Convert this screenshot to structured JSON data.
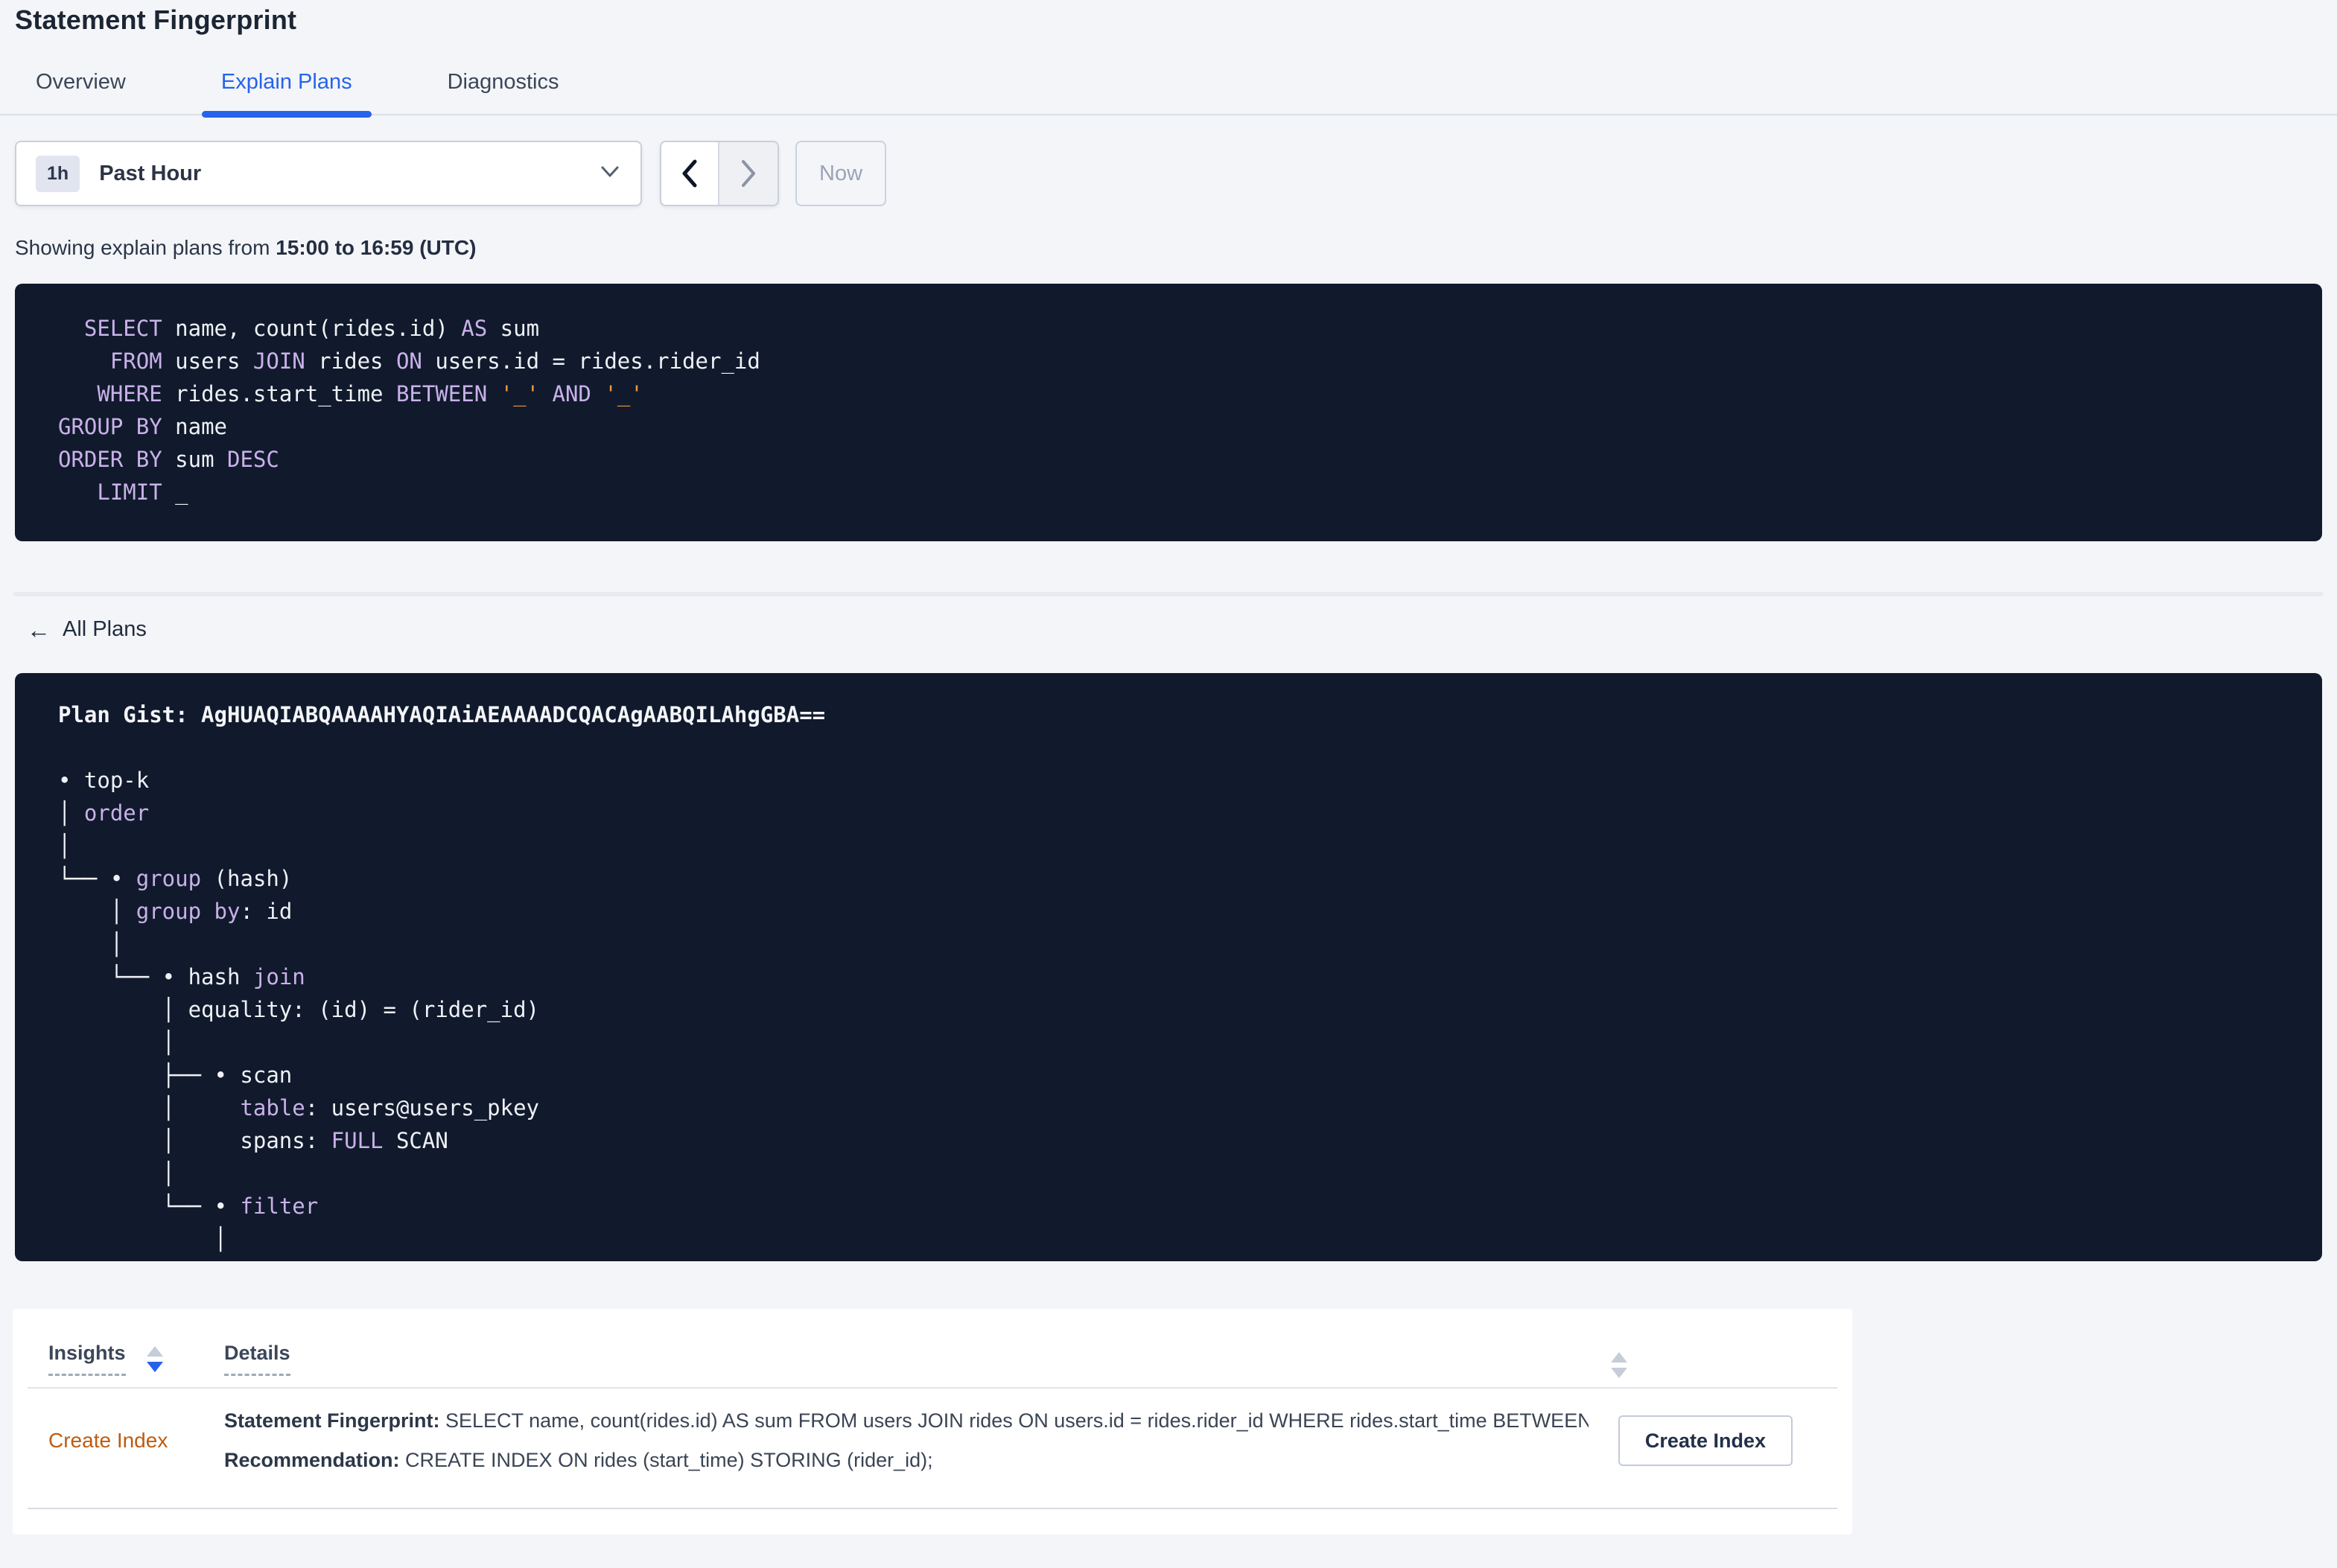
{
  "page": {
    "title": "Statement Fingerprint"
  },
  "tabs": {
    "active_index": 1,
    "items": [
      {
        "label": "Overview"
      },
      {
        "label": "Explain Plans"
      },
      {
        "label": "Diagnostics"
      }
    ]
  },
  "time_picker": {
    "interval_badge": "1h",
    "selected_label": "Past Hour",
    "now_label": "Now"
  },
  "showing_line": {
    "prefix": "Showing explain plans from ",
    "bold_range": "15:00 to 16:59 (UTC)"
  },
  "colors": {
    "accent_blue": "#2563eb",
    "panel_bg": "#111a2c",
    "keyword_purple": "#c9b1ea",
    "code_text": "#eef1f6",
    "string_orange": "#ee9744",
    "insight_link_orange": "#bf5b10"
  },
  "sql_panel": {
    "lines": [
      [
        [
          "kw",
          "  SELECT"
        ],
        [
          "pl",
          " name, count(rides.id) "
        ],
        [
          "kw",
          "AS"
        ],
        [
          "pl",
          " sum"
        ]
      ],
      [
        [
          "kw",
          "    FROM"
        ],
        [
          "pl",
          " users "
        ],
        [
          "kw",
          "JOIN"
        ],
        [
          "pl",
          " rides "
        ],
        [
          "kw",
          "ON"
        ],
        [
          "pl",
          " users.id = rides.rider_id"
        ]
      ],
      [
        [
          "kw",
          "   WHERE"
        ],
        [
          "pl",
          " rides.start_time "
        ],
        [
          "kw",
          "BETWEEN"
        ],
        [
          "pl",
          " "
        ],
        [
          "str",
          "'_'"
        ],
        [
          "pl",
          " "
        ],
        [
          "kw",
          "AND"
        ],
        [
          "pl",
          " "
        ],
        [
          "str",
          "'_'"
        ]
      ],
      [
        [
          "kw",
          "GROUP BY"
        ],
        [
          "pl",
          " name"
        ]
      ],
      [
        [
          "kw",
          "ORDER BY"
        ],
        [
          "pl",
          " sum "
        ],
        [
          "kw",
          "DESC"
        ]
      ],
      [
        [
          "kw",
          "   LIMIT"
        ],
        [
          "pl",
          " _"
        ]
      ]
    ]
  },
  "all_plans": {
    "label": "All Plans"
  },
  "plan_panel": {
    "lines": [
      [
        [
          "b",
          "Plan Gist: AgHUAQIABQAAAAHYAQIAiAEAAAADCQACAgAABQILAhgGBA=="
        ]
      ],
      [],
      [
        [
          "pl",
          "• top-k"
        ]
      ],
      [
        [
          "pl",
          "│ "
        ],
        [
          "kw",
          "order"
        ]
      ],
      [
        [
          "pl",
          "│"
        ]
      ],
      [
        [
          "pl",
          "└── • "
        ],
        [
          "kw",
          "group"
        ],
        [
          "pl",
          " (hash)"
        ]
      ],
      [
        [
          "pl",
          "    │ "
        ],
        [
          "kw",
          "group by"
        ],
        [
          "pl",
          ": id"
        ]
      ],
      [
        [
          "pl",
          "    │"
        ]
      ],
      [
        [
          "pl",
          "    └── • hash "
        ],
        [
          "kw",
          "join"
        ]
      ],
      [
        [
          "pl",
          "        │ equality: (id) = (rider_id)"
        ]
      ],
      [
        [
          "pl",
          "        │"
        ]
      ],
      [
        [
          "pl",
          "        ├── • scan"
        ]
      ],
      [
        [
          "pl",
          "        │     "
        ],
        [
          "kw",
          "table"
        ],
        [
          "pl",
          ": users@users_pkey"
        ]
      ],
      [
        [
          "pl",
          "        │     spans: "
        ],
        [
          "kw",
          "FULL"
        ],
        [
          "pl",
          " SCAN"
        ]
      ],
      [
        [
          "pl",
          "        │"
        ]
      ],
      [
        [
          "pl",
          "        └── • "
        ],
        [
          "kw",
          "filter"
        ]
      ],
      [
        [
          "pl",
          "            │"
        ]
      ]
    ]
  },
  "insights_table": {
    "headers": [
      {
        "label": "Insights"
      },
      {
        "label": "Details"
      }
    ],
    "rows": [
      {
        "insight": "Create Index",
        "detail_line1_label": "Statement Fingerprint:",
        "detail_line1_text": " SELECT name, count(rides.id) AS sum FROM users JOIN rides ON users.id = rides.rider_id WHERE rides.start_time BETWEEN '_…",
        "detail_line2_label": "Recommendation:",
        "detail_line2_text": " CREATE INDEX ON rides (start_time) STORING (rider_id);",
        "action_label": "Create Index"
      }
    ]
  }
}
